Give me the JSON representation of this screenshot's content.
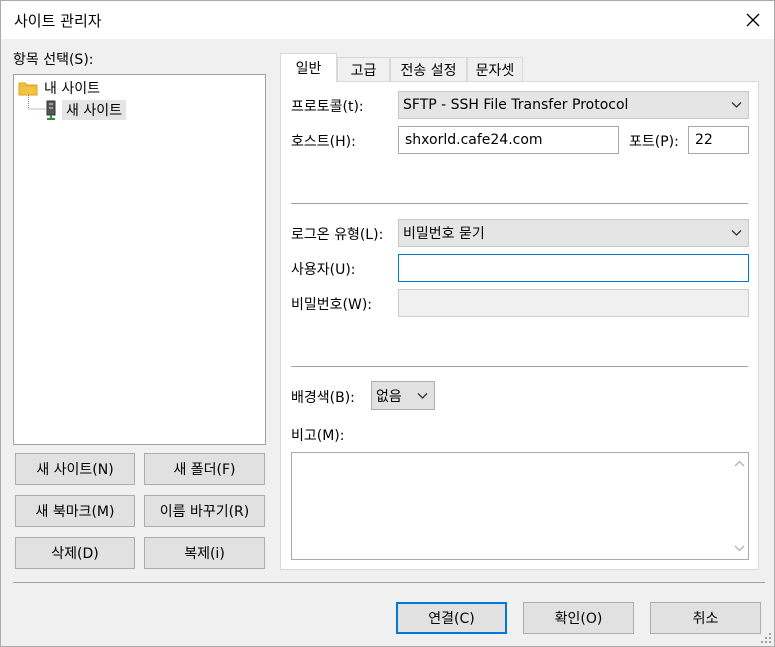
{
  "window": {
    "title": "사이트 관리자"
  },
  "left": {
    "heading": "항목 선택(S):",
    "tree": [
      {
        "label": "내 사이트",
        "icon": "folder-icon",
        "selected": false
      },
      {
        "label": "새 사이트",
        "icon": "server-icon",
        "selected": true
      }
    ],
    "buttons": {
      "new_site": "새 사이트(N)",
      "new_folder": "새 폴더(F)",
      "new_bookmark": "새 북마크(M)",
      "rename": "이름 바꾸기(R)",
      "delete": "삭제(D)",
      "duplicate": "복제(i)"
    }
  },
  "tabs": [
    {
      "label": "일반",
      "active": true
    },
    {
      "label": "고급",
      "active": false
    },
    {
      "label": "전송 설정",
      "active": false
    },
    {
      "label": "문자셋",
      "active": false
    }
  ],
  "general": {
    "protocol_label": "프로토콜(t):",
    "protocol_value": "SFTP - SSH File Transfer Protocol",
    "host_label": "호스트(H):",
    "host_value": "shxorld.cafe24.com",
    "port_label": "포트(P):",
    "port_value": "22",
    "logon_type_label": "로그온 유형(L):",
    "logon_type_value": "비밀번호 묻기",
    "user_label": "사용자(U):",
    "user_value": "",
    "password_label": "비밀번호(W):",
    "password_value": "",
    "background_label": "배경색(B):",
    "background_value": "없음",
    "comments_label": "비고(M):",
    "comments_value": ""
  },
  "footer": {
    "connect": "연결(C)",
    "ok": "확인(O)",
    "cancel": "취소"
  },
  "colors": {
    "dialog_bg": "#f0f0f0",
    "focus_border": "#0078d7",
    "field_border": "#a9a9a9"
  }
}
